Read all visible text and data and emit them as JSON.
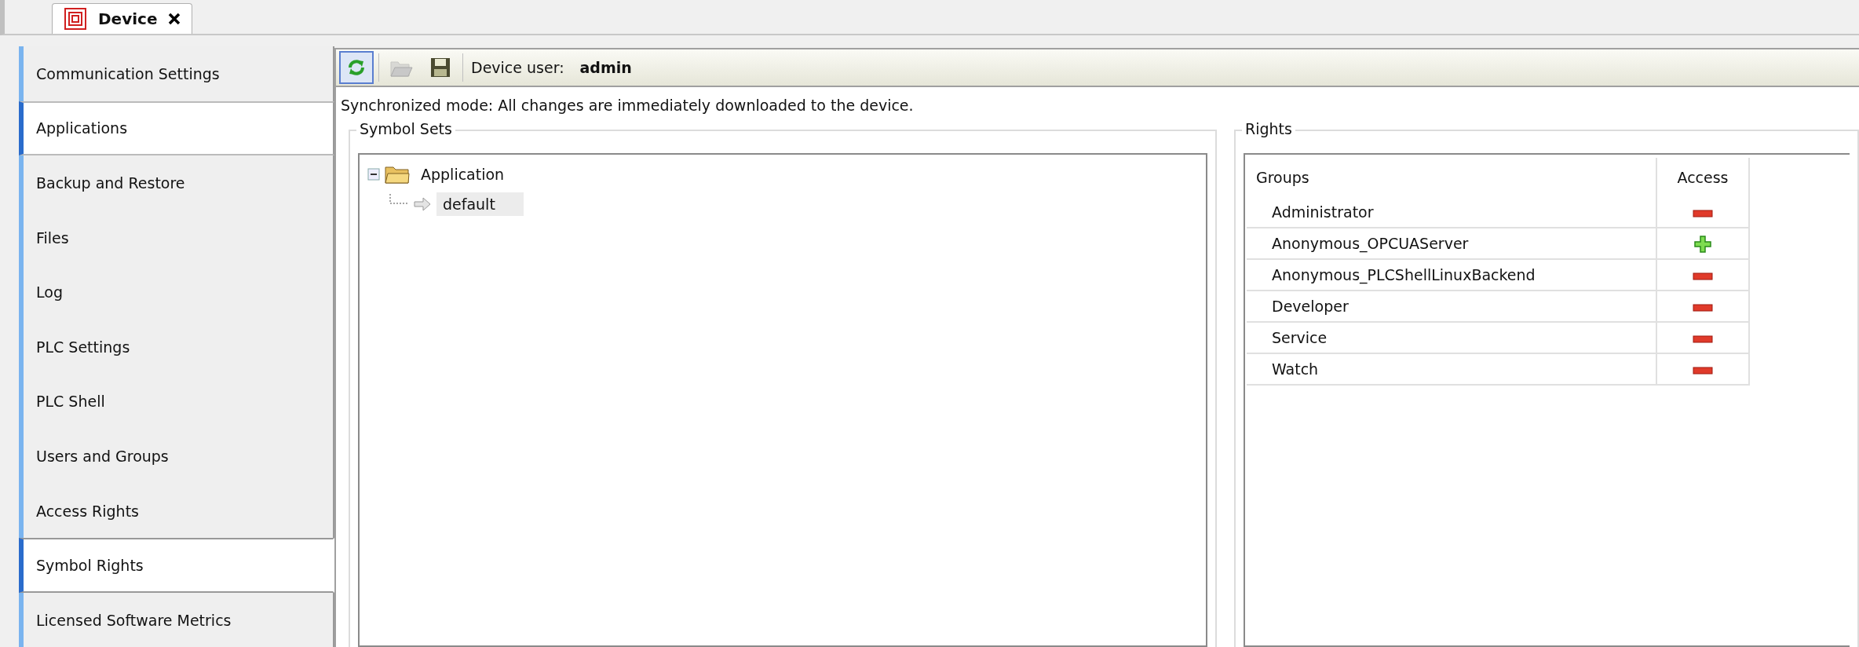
{
  "editor_tabs": [
    {
      "label": "Device",
      "selected": true,
      "closable": true
    }
  ],
  "sidebar": {
    "items": [
      {
        "label": "Communication Settings",
        "selected": false,
        "hovered": false
      },
      {
        "label": "Applications",
        "selected": false,
        "hovered": true
      },
      {
        "label": "Backup and Restore",
        "selected": false,
        "hovered": false
      },
      {
        "label": "Files",
        "selected": false,
        "hovered": false
      },
      {
        "label": "Log",
        "selected": false,
        "hovered": false
      },
      {
        "label": "PLC Settings",
        "selected": false,
        "hovered": false
      },
      {
        "label": "PLC Shell",
        "selected": false,
        "hovered": false
      },
      {
        "label": "Users and Groups",
        "selected": false,
        "hovered": false
      },
      {
        "label": "Access Rights",
        "selected": false,
        "hovered": false
      },
      {
        "label": "Symbol Rights",
        "selected": true,
        "hovered": false
      },
      {
        "label": "Licensed Software Metrics",
        "selected": false,
        "hovered": false
      }
    ]
  },
  "toolbar": {
    "refresh_active": true,
    "open_disabled": true,
    "user_label": "Device user:",
    "user_value": "admin"
  },
  "status_message": "Synchronized mode: All changes are immediately downloaded to the device.",
  "symbol_sets": {
    "title": "Symbol Sets",
    "tree": [
      {
        "label": "Application",
        "kind": "folder",
        "expanded": true,
        "selected": false,
        "children": [
          {
            "label": "default",
            "kind": "set",
            "selected": true
          }
        ]
      }
    ]
  },
  "rights": {
    "title": "Rights",
    "columns": [
      "Groups",
      "Access"
    ],
    "rows": [
      {
        "group": "Administrator",
        "granted": false
      },
      {
        "group": "Anonymous_OPCUAServer",
        "granted": true
      },
      {
        "group": "Anonymous_PLCShellLinuxBackend",
        "granted": false
      },
      {
        "group": "Developer",
        "granted": false
      },
      {
        "group": "Service",
        "granted": false
      },
      {
        "group": "Watch",
        "granted": false
      }
    ]
  }
}
